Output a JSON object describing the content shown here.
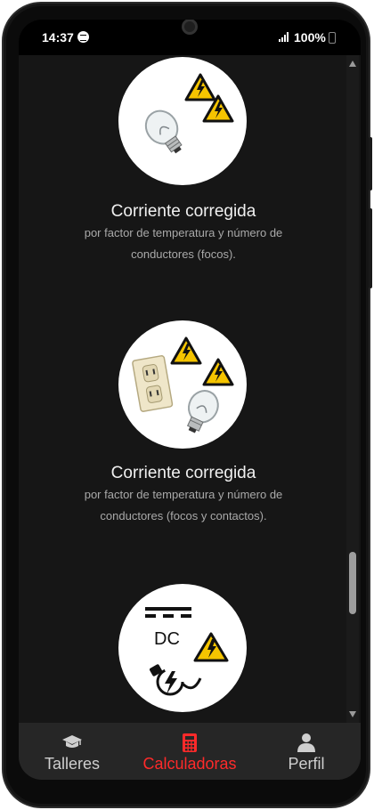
{
  "status_bar": {
    "time": "14:37",
    "battery": "100%"
  },
  "cards": [
    {
      "title": "Corriente corregida",
      "description": "por factor de temperatura y número de conductores (focos)."
    },
    {
      "title": "Corriente corregida",
      "description": "por factor de temperatura y número de conductores (focos y contactos)."
    },
    {
      "title": "",
      "description": "",
      "icon_text": "DC"
    }
  ],
  "tabs": [
    {
      "label": "Talleres",
      "icon": "graduation-cap-icon",
      "active": false
    },
    {
      "label": "Calculadoras",
      "icon": "calculator-icon",
      "active": true
    },
    {
      "label": "Perfil",
      "icon": "user-icon",
      "active": false
    }
  ],
  "colors": {
    "accent": "#ff2a2a",
    "background": "#161616",
    "tabbar": "#262626",
    "warning_yellow": "#f5c400"
  }
}
